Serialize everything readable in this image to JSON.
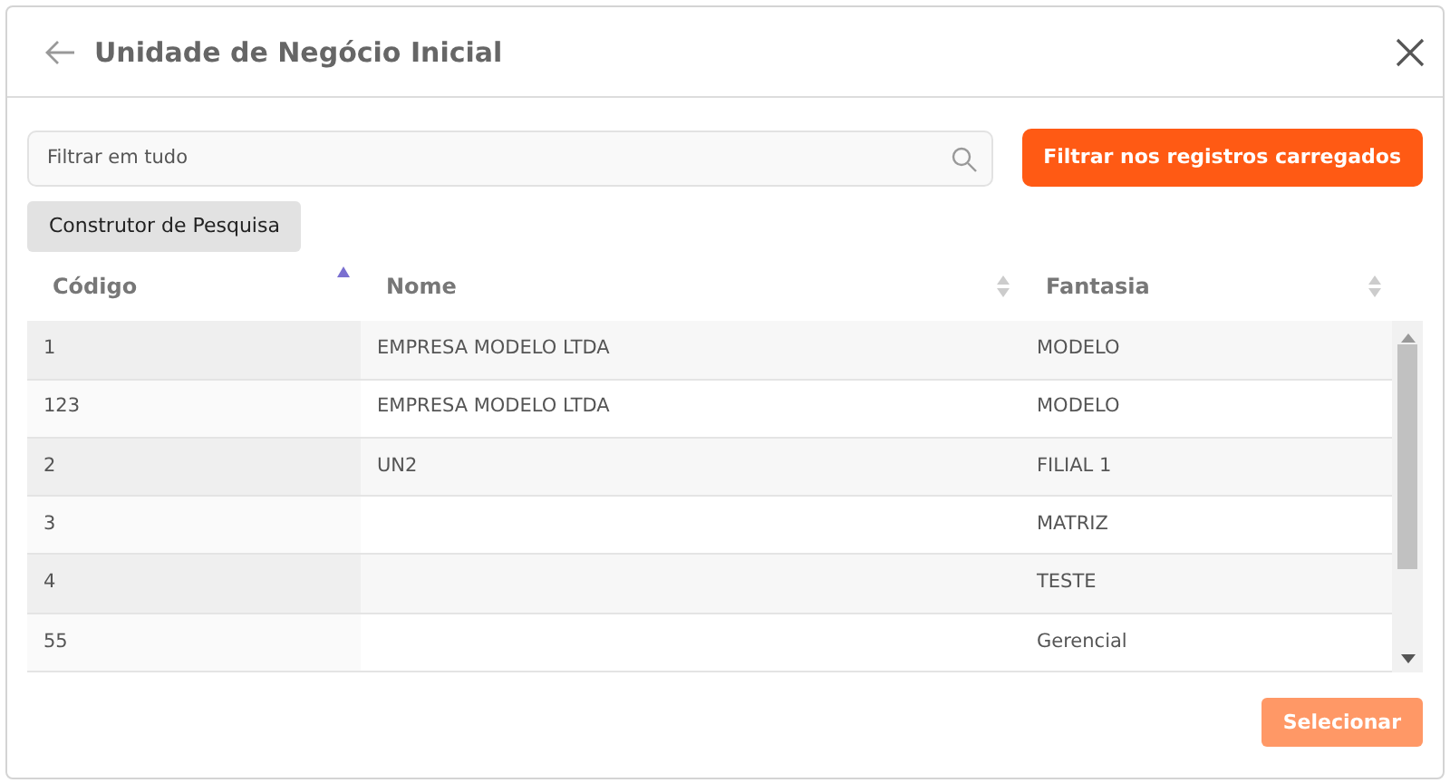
{
  "dialog": {
    "title": "Unidade de Negócio Inicial"
  },
  "search": {
    "placeholder": "Filtrar em tudo"
  },
  "filter_button": {
    "label": "Filtrar nos registros carregados"
  },
  "query_builder_button": {
    "label": "Construtor de Pesquisa"
  },
  "table": {
    "columns": [
      {
        "label": "Código",
        "sorted_ascending": true
      },
      {
        "label": "Nome",
        "sorted_ascending": false
      },
      {
        "label": "Fantasia",
        "sorted_ascending": false
      }
    ],
    "rows": [
      [
        "1",
        "EMPRESA MODELO LTDA",
        "MODELO"
      ],
      [
        "123",
        "EMPRESA MODELO LTDA",
        "MODELO"
      ],
      [
        "2",
        "UN2",
        "FILIAL 1"
      ],
      [
        "3",
        null,
        "MATRIZ"
      ],
      [
        "4",
        null,
        "TESTE"
      ],
      [
        "55",
        null,
        "Gerencial"
      ]
    ]
  },
  "select_button": {
    "label": "Selecionar",
    "disabled": true
  }
}
